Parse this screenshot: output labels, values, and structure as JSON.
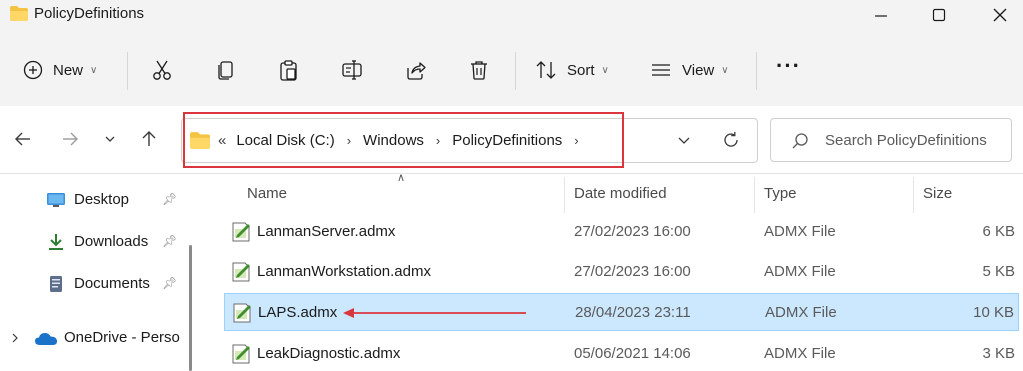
{
  "window": {
    "title": "PolicyDefinitions",
    "minimize_icon": "minimize-icon",
    "maximize_icon": "maximize-icon",
    "close_icon": "close-icon"
  },
  "toolbar": {
    "new_label": "New",
    "sort_label": "Sort",
    "view_label": "View",
    "more_label": "···"
  },
  "address": {
    "overflow": "«",
    "crumbs": [
      "Local Disk (C:)",
      "Windows",
      "PolicyDefinitions"
    ],
    "separator": "›"
  },
  "search": {
    "placeholder": "Search PolicyDefinitions"
  },
  "sidebar": {
    "items": [
      {
        "label": "Desktop",
        "pinned": true,
        "icon": "desktop-icon"
      },
      {
        "label": "Downloads",
        "pinned": true,
        "icon": "downloads-icon"
      },
      {
        "label": "Documents",
        "pinned": true,
        "icon": "documents-icon"
      },
      {
        "label": "OneDrive - Perso",
        "pinned": false,
        "icon": "onedrive-icon"
      }
    ]
  },
  "columns": {
    "name": "Name",
    "date": "Date modified",
    "type": "Type",
    "size": "Size"
  },
  "files": [
    {
      "name": "LanmanServer.admx",
      "date": "27/02/2023 16:00",
      "type": "ADMX File",
      "size": "6 KB",
      "selected": false
    },
    {
      "name": "LanmanWorkstation.admx",
      "date": "27/02/2023 16:00",
      "type": "ADMX File",
      "size": "5 KB",
      "selected": false
    },
    {
      "name": "LAPS.admx",
      "date": "28/04/2023 23:11",
      "type": "ADMX File",
      "size": "10 KB",
      "selected": true
    },
    {
      "name": "LeakDiagnostic.admx",
      "date": "05/06/2021 14:06",
      "type": "ADMX File",
      "size": "3 KB",
      "selected": false
    }
  ],
  "colors": {
    "highlight": "#d9363e",
    "selection": "#cce8ff",
    "folder": "#f5c342"
  }
}
